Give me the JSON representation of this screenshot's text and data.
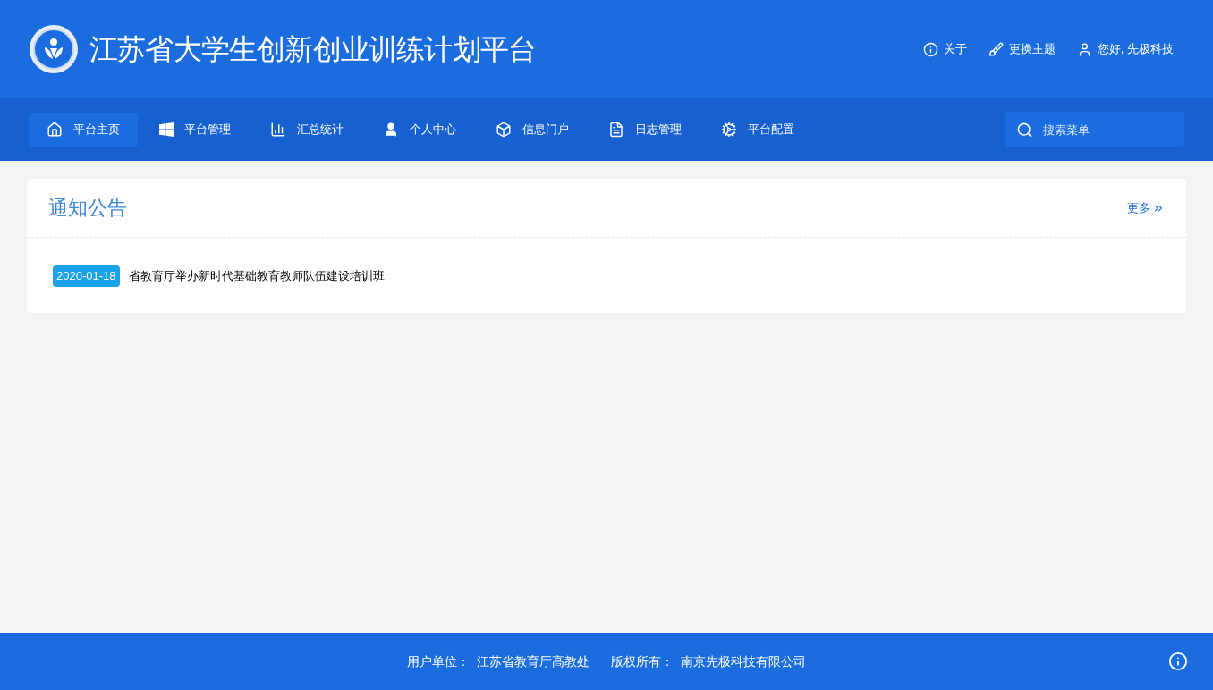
{
  "header": {
    "title": "江苏省大学生创新创业训练计划平台",
    "links": [
      {
        "kind": "info",
        "label": "关于"
      },
      {
        "kind": "brush",
        "label": "更换主题"
      },
      {
        "kind": "user",
        "label": "您好, 先极科技"
      }
    ]
  },
  "nav": {
    "items": [
      {
        "kind": "home",
        "label": "平台主页",
        "selected": true
      },
      {
        "kind": "windows",
        "label": "平台管理",
        "selected": false
      },
      {
        "kind": "chart",
        "label": "汇总统计",
        "selected": false
      },
      {
        "kind": "person",
        "label": "个人中心",
        "selected": false
      },
      {
        "kind": "box",
        "label": "信息门户",
        "selected": false
      },
      {
        "kind": "file",
        "label": "日志管理",
        "selected": false
      },
      {
        "kind": "cogs",
        "label": "平台配置",
        "selected": false
      }
    ],
    "search": {
      "placeholder": "搜索菜单"
    }
  },
  "notice_panel": {
    "title": "通知公告",
    "more": "更多",
    "items": [
      {
        "date": "2020-01-18",
        "text": "省教育厅举办新时代基础教育教师队伍建设培训班"
      }
    ]
  },
  "footer": {
    "fields": [
      {
        "label": "用户单位：",
        "value": "江苏省教育厅高教处"
      },
      {
        "label": "版权所有：",
        "value": "南京先极科技有限公司"
      }
    ]
  }
}
